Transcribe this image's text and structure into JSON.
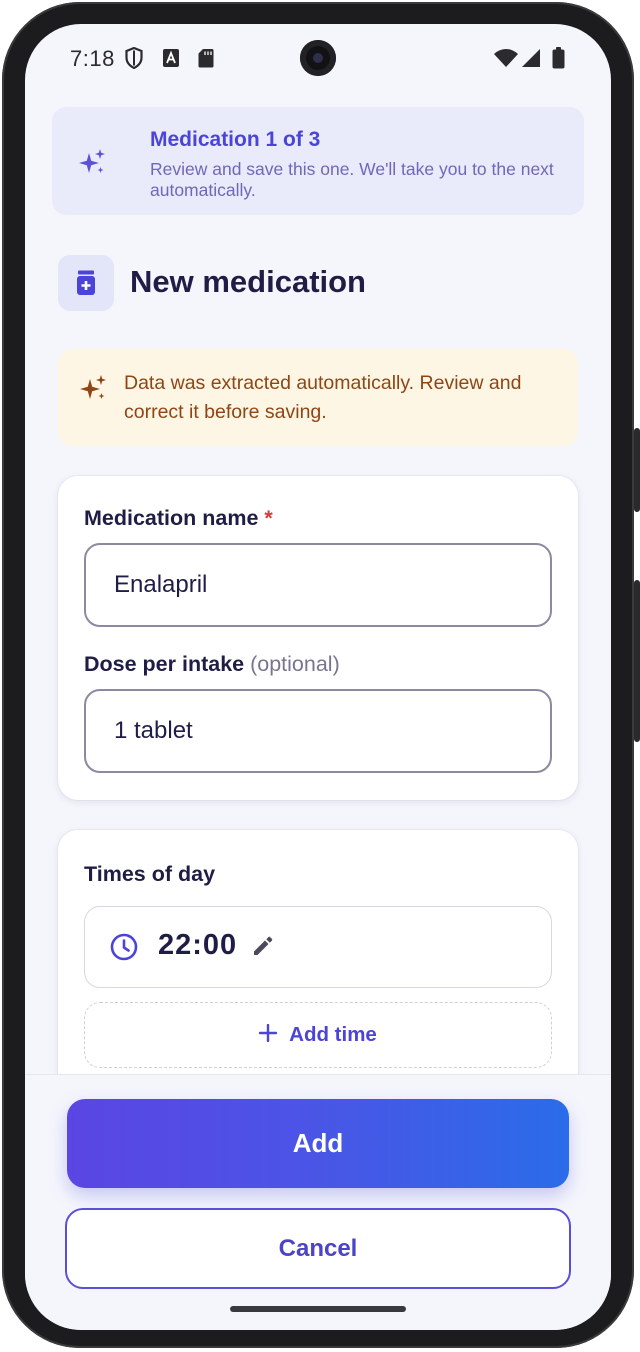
{
  "status_bar": {
    "time": "7:18",
    "left_icons": [
      "shield-icon",
      "text-a-icon",
      "sd-card-icon"
    ],
    "right_icons": [
      "wifi-icon",
      "cell-signal-icon",
      "battery-icon"
    ]
  },
  "banner": {
    "title": "Medication 1 of 3",
    "subtitle": "Review and save this one. We'll take you to the next automatically.",
    "icon": "sparkles-icon"
  },
  "header": {
    "title": "New medication",
    "icon": "medicine-bottle-icon"
  },
  "notice": {
    "text": "Data was extracted automatically. Review and correct it before saving.",
    "icon": "sparkles-icon"
  },
  "form": {
    "name_label": "Medication name",
    "name_required_mark": "*",
    "name_value": "Enalapril",
    "dose_label": "Dose per intake",
    "dose_optional": "(optional)",
    "dose_value": "1 tablet"
  },
  "times": {
    "label": "Times of day",
    "items": [
      {
        "value": "22:00"
      }
    ],
    "add_label": "Add time"
  },
  "actions": {
    "add_label": "Add",
    "cancel_label": "Cancel"
  },
  "colors": {
    "accent": "#4b44d8",
    "banner_bg": "#e9ebfb",
    "notice_bg": "#fdf6e5",
    "notice_text": "#8f4514",
    "required": "#d63a3a",
    "background": "#f5f6fc"
  }
}
